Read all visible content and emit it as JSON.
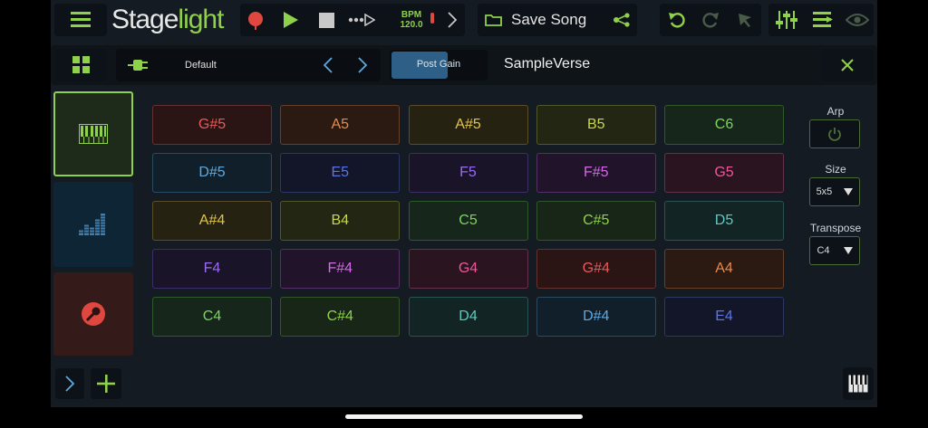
{
  "app": {
    "logo_left": "Stage",
    "logo_right": "light"
  },
  "transport": {
    "bpm_label": "BPM",
    "bpm_value": "120.0"
  },
  "song": {
    "save_label": "Save Song"
  },
  "instrument": {
    "preset": "Default",
    "gain_label": "Post Gain",
    "gain_level": 0.6,
    "track_name": "SampleVerse"
  },
  "pads": [
    [
      "G#5",
      "A5",
      "A#5",
      "B5",
      "C6"
    ],
    [
      "D#5",
      "E5",
      "F5",
      "F#5",
      "G5"
    ],
    [
      "A#4",
      "B4",
      "C5",
      "C#5",
      "D5"
    ],
    [
      "F4",
      "F#4",
      "G4",
      "G#4",
      "A4"
    ],
    [
      "C4",
      "C#4",
      "D4",
      "D#4",
      "E4"
    ]
  ],
  "controls": {
    "arp_label": "Arp",
    "size_label": "Size",
    "size_value": "5x5",
    "transpose_label": "Transpose",
    "transpose_value": "C4"
  },
  "icons": {
    "menu": "hamburger-icon",
    "record": "record-icon",
    "play": "play-icon",
    "stop": "stop-icon",
    "next": "chevron-right-icon",
    "folder": "folder-icon",
    "share": "share-icon",
    "undo": "undo-icon",
    "redo": "redo-icon",
    "cursor": "cursor-icon",
    "mixer": "mixer-icon",
    "list": "list-icon",
    "eye": "eye-icon"
  },
  "colors": {
    "accent": "#8fd14a",
    "record": "#e0473e",
    "background": "#141b22",
    "panel": "#0d1218"
  }
}
